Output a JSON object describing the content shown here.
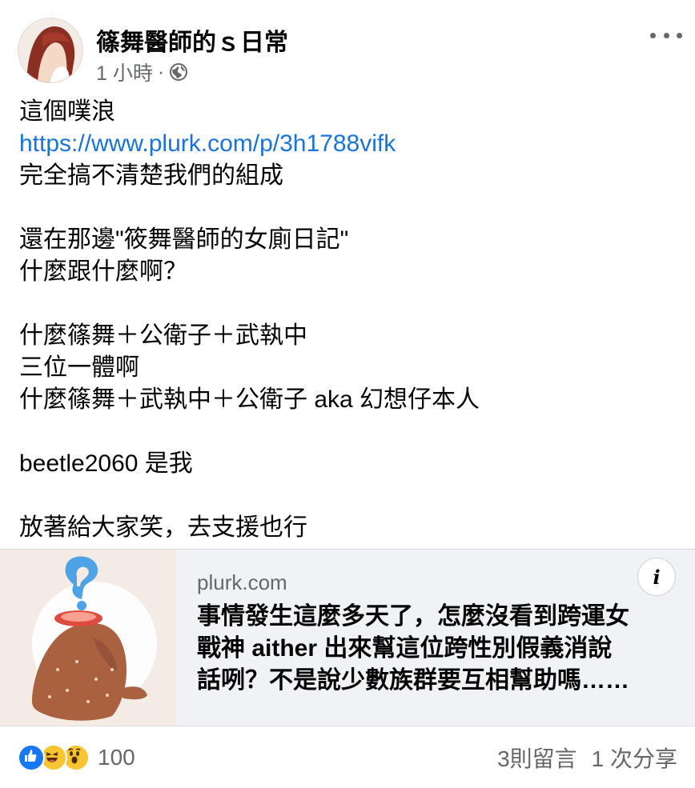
{
  "post": {
    "author": "篠舞醫師的ｓ日常",
    "time": "1 小時",
    "separator": "·",
    "privacy_icon": "globe-icon",
    "more_icon": "more-icon",
    "body_lines": [
      {
        "text": "這個噗浪",
        "type": "text"
      },
      {
        "text": "https://www.plurk.com/p/3h1788vifk",
        "type": "link"
      },
      {
        "text": "完全搞不清楚我們的組成",
        "type": "text"
      },
      {
        "text": "",
        "type": "blank"
      },
      {
        "text": "還在那邊\"筱舞醫師的女廁日記\"",
        "type": "text"
      },
      {
        "text": "什麼跟什麼啊？",
        "type": "text"
      },
      {
        "text": "",
        "type": "blank"
      },
      {
        "text": "什麼篠舞＋公衛子＋武執中",
        "type": "text"
      },
      {
        "text": "三位一體啊",
        "type": "text"
      },
      {
        "text": "什麼篠舞＋武執中＋公衛子 aka 幻想仔本人",
        "type": "text"
      },
      {
        "text": "",
        "type": "blank"
      },
      {
        "text": "beetle2060 是我",
        "type": "text"
      },
      {
        "text": "",
        "type": "blank"
      },
      {
        "text": "放著給大家笑，去支援也行",
        "type": "text"
      }
    ]
  },
  "link_card": {
    "domain": "plurk.com",
    "title_lines": [
      "事情發生這麼多天了，怎麼沒看到跨運女",
      "戰神 aither 出來幫這位跨性別假義消說",
      "話咧？不是說少數族群要互相幫助嗎……"
    ],
    "info_label": "i",
    "thumbnail_icon": "bear-question-mark-illustration"
  },
  "footer": {
    "reaction_icons": [
      "like-icon",
      "haha-icon",
      "wow-icon"
    ],
    "reaction_count": "100",
    "comments": "3則留言",
    "shares": "1 次分享"
  },
  "colors": {
    "link": "#1a73d9",
    "secondary_text": "#65676b",
    "card_bg": "#f0f2f5",
    "like_blue": "#1877f2",
    "emoji_yellow": "#f7c531"
  }
}
